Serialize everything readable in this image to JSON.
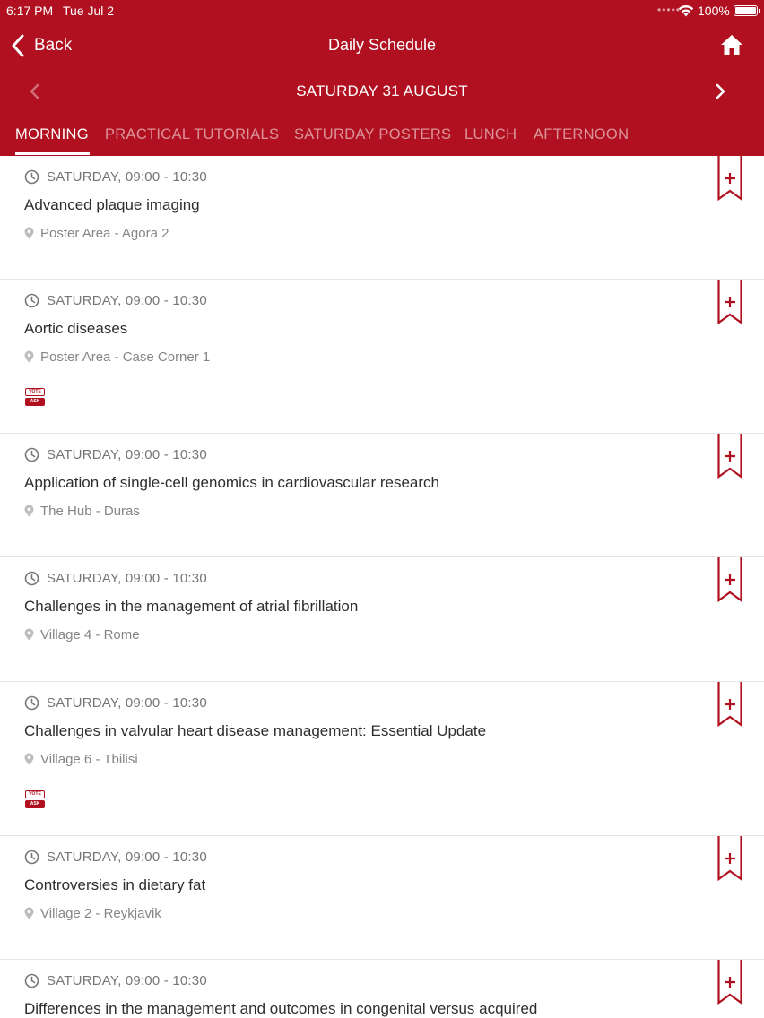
{
  "status_bar": {
    "time": "6:17 PM",
    "date": "Tue Jul 2",
    "signal_dots": "•••••",
    "battery": "100%"
  },
  "nav": {
    "back_label": "Back",
    "title": "Daily Schedule",
    "home_icon": "home-icon"
  },
  "date_bar": {
    "label": "SATURDAY 31 AUGUST"
  },
  "tabs": [
    {
      "label": "MORNING",
      "active": true
    },
    {
      "label": "PRACTICAL TUTORIALS",
      "active": false
    },
    {
      "label": "SATURDAY POSTERS",
      "active": false
    },
    {
      "label": "LUNCH",
      "active": false
    },
    {
      "label": "AFTERNOON",
      "active": false
    }
  ],
  "sessions": [
    {
      "time": "SATURDAY, 09:00 - 10:30",
      "title": "Advanced plaque imaging",
      "location": "Poster Area - Agora 2",
      "vote": false
    },
    {
      "time": "SATURDAY, 09:00 - 10:30",
      "title": "Aortic diseases",
      "location": "Poster Area - Case Corner 1",
      "vote": true
    },
    {
      "time": "SATURDAY, 09:00 - 10:30",
      "title": "Application of single-cell genomics in cardiovascular research",
      "location": "The Hub - Duras",
      "vote": false
    },
    {
      "time": "SATURDAY, 09:00 - 10:30",
      "title": "Challenges in the management of atrial fibrillation",
      "location": "Village 4 - Rome",
      "vote": false
    },
    {
      "time": "SATURDAY, 09:00 - 10:30",
      "title": "Challenges in valvular heart disease management: Essential Update",
      "location": "Village 6 - Tbilisi",
      "vote": true
    },
    {
      "time": "SATURDAY, 09:00 - 10:30",
      "title": "Controversies in dietary fat",
      "location": "Village 2 - Reykjavik",
      "vote": false
    },
    {
      "time": "SATURDAY, 09:00 - 10:30",
      "title": "Differences in the management and outcomes in congenital versus acquired",
      "location": "",
      "vote": false
    }
  ],
  "vote_badge": {
    "top": "VOTE",
    "bottom": "ASK"
  },
  "colors": {
    "brand": "#b0101f"
  }
}
